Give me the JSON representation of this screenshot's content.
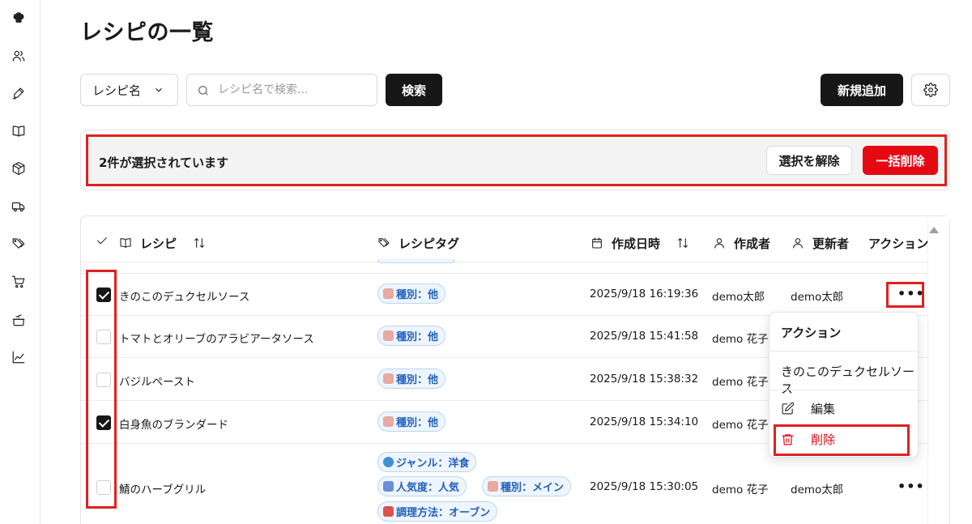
{
  "sidebar": {
    "items": [
      {
        "icon": "chef-hat-icon"
      },
      {
        "icon": "users-icon"
      },
      {
        "icon": "pen-icon"
      },
      {
        "icon": "book-icon"
      },
      {
        "icon": "box-icon"
      },
      {
        "icon": "truck-icon"
      },
      {
        "icon": "tags-icon"
      },
      {
        "icon": "cart-icon"
      },
      {
        "icon": "pot-icon"
      },
      {
        "icon": "chart-icon"
      }
    ]
  },
  "page": {
    "title": "レシピの一覧"
  },
  "toolbar": {
    "filter_select": "レシピ名",
    "search_placeholder": "レシピ名で検索...",
    "search_label": "検索",
    "new_label": "新規追加"
  },
  "selection": {
    "text": "2件が選択されています",
    "clear_label": "選択を解除",
    "bulk_delete_label": "一括削除"
  },
  "table": {
    "headers": {
      "recipe": "レシピ",
      "tags": "レシピタグ",
      "created_at": "作成日時",
      "creator": "作成者",
      "updater": "更新者",
      "action": "アクション"
    },
    "rows": [
      {
        "checked": true,
        "name": "きのこのデュクセルソース",
        "tags": [
          "種別：他"
        ],
        "created_at": "2025/9/18 16:19:36",
        "creator": "demo太郎",
        "updater": "demo太郎"
      },
      {
        "checked": false,
        "name": "トマトとオリーブのアラビアータソース",
        "tags": [
          "種別：他"
        ],
        "created_at": "2025/9/18 15:41:58",
        "creator": "demo 花子",
        "updater": ""
      },
      {
        "checked": false,
        "name": "バジルペースト",
        "tags": [
          "種別：他"
        ],
        "created_at": "2025/9/18 15:38:32",
        "creator": "demo 花子",
        "updater": ""
      },
      {
        "checked": true,
        "name": "白身魚のブランダード",
        "tags": [
          "種別：他"
        ],
        "created_at": "2025/9/18 15:34:10",
        "creator": "demo 花子",
        "updater": ""
      },
      {
        "checked": false,
        "name": "鯖のハーブグリル",
        "tags": [
          "ジャンル：洋食",
          "人気度：人気",
          "種別：メイン",
          "調理方法：オーブン"
        ],
        "created_at": "2025/9/18 15:30:05",
        "creator": "demo 花子",
        "updater": "demo太郎"
      }
    ],
    "more_label": "•••"
  },
  "action_menu": {
    "title": "アクション",
    "recipe_name": "きのこのデュクセルソース",
    "edit_label": "編集",
    "delete_label": "削除"
  },
  "colors": {
    "accent_dark": "#171717",
    "danger": "#e50914",
    "tag_text": "#1f5fbf",
    "highlight_frame": "#e02020"
  }
}
